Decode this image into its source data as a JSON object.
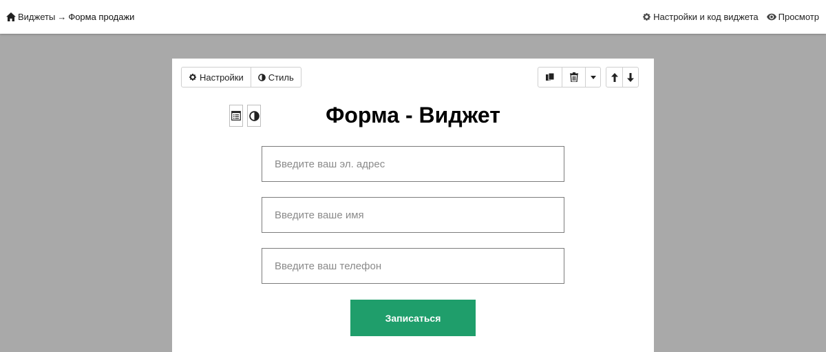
{
  "breadcrumb": {
    "root_label": "Виджеты",
    "separator": "→",
    "current_label": "Форма продажи"
  },
  "header_links": {
    "settings_code": "Настройки и код виджета",
    "preview": "Просмотр"
  },
  "toolbar": {
    "settings_label": "Настройки",
    "style_label": "Стиль",
    "icons": [
      "copy-icon",
      "trash-icon",
      "caret-down-icon",
      "arrow-up-icon",
      "arrow-down-icon"
    ]
  },
  "widget": {
    "title": "Форма - Виджет",
    "fields": [
      {
        "placeholder": "Введите ваш эл. адрес",
        "value": ""
      },
      {
        "placeholder": "Введите ваше имя",
        "value": ""
      },
      {
        "placeholder": "Введите ваш телефон",
        "value": ""
      }
    ],
    "submit_label": "Записаться"
  },
  "colors": {
    "background": "#a9a9a9",
    "accent": "#1f9e6b"
  }
}
